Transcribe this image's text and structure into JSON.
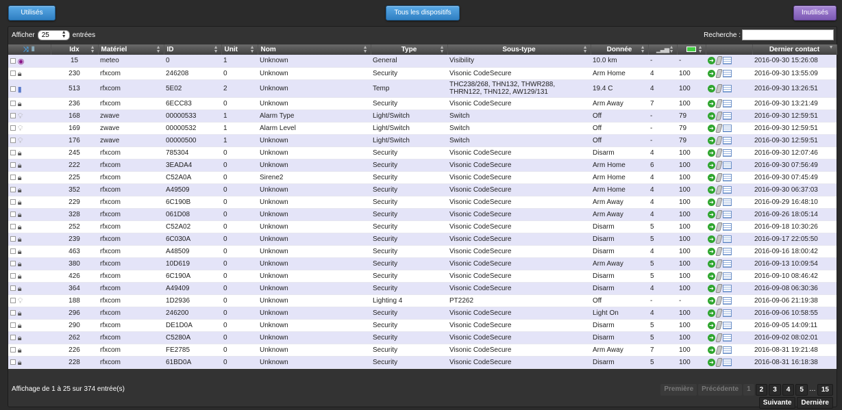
{
  "buttons": {
    "used": "Utilisés",
    "all": "Tous les dispositifs",
    "unused": "Inutilisés"
  },
  "toolbar": {
    "show_prefix": "Afficher",
    "page_size": "25",
    "show_suffix": "entrées",
    "search_label": "Recherche :",
    "search_value": ""
  },
  "table": {
    "headers": {
      "idx": "Idx",
      "hardware": "Matériel",
      "id": "ID",
      "unit": "Unit",
      "name": "Nom",
      "type": "Type",
      "subtype": "Sous-type",
      "data": "Donnée",
      "last_seen": "Dernier contact"
    },
    "rows": [
      {
        "icon": "eye",
        "idx": "15",
        "hw": "meteo",
        "id": "0",
        "unit": "1",
        "name": "Unknown",
        "type": "General",
        "sub": "Visibility",
        "data": "10.0 km",
        "sig": "-",
        "batt": "-",
        "last": "2016-09-30 15:26:08"
      },
      {
        "icon": "lock",
        "idx": "230",
        "hw": "rfxcom",
        "id": "246208",
        "unit": "0",
        "name": "Unknown",
        "type": "Security",
        "sub": "Visonic CodeSecure",
        "data": "Arm Home",
        "sig": "4",
        "batt": "100",
        "last": "2016-09-30 13:55:09"
      },
      {
        "icon": "temp",
        "idx": "513",
        "hw": "rfxcom",
        "id": "5E02",
        "unit": "2",
        "name": "Unknown",
        "type": "Temp",
        "sub": "THC238/268, THN132, THWR288, THRN122, THN122, AW129/131",
        "data": "19.4 C",
        "sig": "4",
        "batt": "100",
        "last": "2016-09-30 13:26:51"
      },
      {
        "icon": "lock",
        "idx": "236",
        "hw": "rfxcom",
        "id": "6ECC83",
        "unit": "0",
        "name": "Unknown",
        "type": "Security",
        "sub": "Visonic CodeSecure",
        "data": "Arm Away",
        "sig": "7",
        "batt": "100",
        "last": "2016-09-30 13:21:49"
      },
      {
        "icon": "bulb",
        "idx": "168",
        "hw": "zwave",
        "id": "00000533",
        "unit": "1",
        "name": "Alarm Type",
        "type": "Light/Switch",
        "sub": "Switch",
        "data": "Off",
        "sig": "-",
        "batt": "79",
        "last": "2016-09-30 12:59:51"
      },
      {
        "icon": "bulb",
        "idx": "169",
        "hw": "zwave",
        "id": "00000532",
        "unit": "1",
        "name": "Alarm Level",
        "type": "Light/Switch",
        "sub": "Switch",
        "data": "Off",
        "sig": "-",
        "batt": "79",
        "last": "2016-09-30 12:59:51"
      },
      {
        "icon": "bulb",
        "idx": "176",
        "hw": "zwave",
        "id": "00000500",
        "unit": "1",
        "name": "Unknown",
        "type": "Light/Switch",
        "sub": "Switch",
        "data": "Off",
        "sig": "-",
        "batt": "79",
        "last": "2016-09-30 12:59:51"
      },
      {
        "icon": "lock",
        "idx": "245",
        "hw": "rfxcom",
        "id": "785304",
        "unit": "0",
        "name": "Unknown",
        "type": "Security",
        "sub": "Visonic CodeSecure",
        "data": "Disarm",
        "sig": "4",
        "batt": "100",
        "last": "2016-09-30 12:07:46"
      },
      {
        "icon": "lock",
        "idx": "222",
        "hw": "rfxcom",
        "id": "3EADA4",
        "unit": "0",
        "name": "Unknown",
        "type": "Security",
        "sub": "Visonic CodeSecure",
        "data": "Arm Home",
        "sig": "6",
        "batt": "100",
        "last": "2016-09-30 07:56:49"
      },
      {
        "icon": "lock",
        "idx": "225",
        "hw": "rfxcom",
        "id": "C52A0A",
        "unit": "0",
        "name": "Sirene2",
        "type": "Security",
        "sub": "Visonic CodeSecure",
        "data": "Arm Home",
        "sig": "4",
        "batt": "100",
        "last": "2016-09-30 07:45:49"
      },
      {
        "icon": "lock",
        "idx": "352",
        "hw": "rfxcom",
        "id": "A49509",
        "unit": "0",
        "name": "Unknown",
        "type": "Security",
        "sub": "Visonic CodeSecure",
        "data": "Arm Home",
        "sig": "4",
        "batt": "100",
        "last": "2016-09-30 06:37:03"
      },
      {
        "icon": "lock",
        "idx": "229",
        "hw": "rfxcom",
        "id": "6C190B",
        "unit": "0",
        "name": "Unknown",
        "type": "Security",
        "sub": "Visonic CodeSecure",
        "data": "Arm Away",
        "sig": "4",
        "batt": "100",
        "last": "2016-09-29 16:48:10"
      },
      {
        "icon": "lock",
        "idx": "328",
        "hw": "rfxcom",
        "id": "061D08",
        "unit": "0",
        "name": "Unknown",
        "type": "Security",
        "sub": "Visonic CodeSecure",
        "data": "Arm Away",
        "sig": "4",
        "batt": "100",
        "last": "2016-09-26 18:05:14"
      },
      {
        "icon": "lock",
        "idx": "252",
        "hw": "rfxcom",
        "id": "C52A02",
        "unit": "0",
        "name": "Unknown",
        "type": "Security",
        "sub": "Visonic CodeSecure",
        "data": "Disarm",
        "sig": "5",
        "batt": "100",
        "last": "2016-09-18 10:30:26"
      },
      {
        "icon": "lock",
        "idx": "239",
        "hw": "rfxcom",
        "id": "6C030A",
        "unit": "0",
        "name": "Unknown",
        "type": "Security",
        "sub": "Visonic CodeSecure",
        "data": "Disarm",
        "sig": "5",
        "batt": "100",
        "last": "2016-09-17 22:05:50"
      },
      {
        "icon": "lock",
        "idx": "463",
        "hw": "rfxcom",
        "id": "A48509",
        "unit": "0",
        "name": "Unknown",
        "type": "Security",
        "sub": "Visonic CodeSecure",
        "data": "Disarm",
        "sig": "4",
        "batt": "100",
        "last": "2016-09-16 18:00:42"
      },
      {
        "icon": "lock",
        "idx": "380",
        "hw": "rfxcom",
        "id": "10D619",
        "unit": "0",
        "name": "Unknown",
        "type": "Security",
        "sub": "Visonic CodeSecure",
        "data": "Arm Away",
        "sig": "5",
        "batt": "100",
        "last": "2016-09-13 10:09:54"
      },
      {
        "icon": "lock",
        "idx": "426",
        "hw": "rfxcom",
        "id": "6C190A",
        "unit": "0",
        "name": "Unknown",
        "type": "Security",
        "sub": "Visonic CodeSecure",
        "data": "Disarm",
        "sig": "5",
        "batt": "100",
        "last": "2016-09-10 08:46:42"
      },
      {
        "icon": "lock",
        "idx": "364",
        "hw": "rfxcom",
        "id": "A49409",
        "unit": "0",
        "name": "Unknown",
        "type": "Security",
        "sub": "Visonic CodeSecure",
        "data": "Disarm",
        "sig": "4",
        "batt": "100",
        "last": "2016-09-08 06:30:36"
      },
      {
        "icon": "bulb",
        "idx": "188",
        "hw": "rfxcom",
        "id": "1D2936",
        "unit": "0",
        "name": "Unknown",
        "type": "Lighting 4",
        "sub": "PT2262",
        "data": "Off",
        "sig": "-",
        "batt": "-",
        "last": "2016-09-06 21:19:38"
      },
      {
        "icon": "lock",
        "idx": "296",
        "hw": "rfxcom",
        "id": "246200",
        "unit": "0",
        "name": "Unknown",
        "type": "Security",
        "sub": "Visonic CodeSecure",
        "data": "Light On",
        "sig": "4",
        "batt": "100",
        "last": "2016-09-06 10:58:55"
      },
      {
        "icon": "lock",
        "idx": "290",
        "hw": "rfxcom",
        "id": "DE1D0A",
        "unit": "0",
        "name": "Unknown",
        "type": "Security",
        "sub": "Visonic CodeSecure",
        "data": "Disarm",
        "sig": "5",
        "batt": "100",
        "last": "2016-09-05 14:09:11"
      },
      {
        "icon": "lock",
        "idx": "262",
        "hw": "rfxcom",
        "id": "C5280A",
        "unit": "0",
        "name": "Unknown",
        "type": "Security",
        "sub": "Visonic CodeSecure",
        "data": "Disarm",
        "sig": "5",
        "batt": "100",
        "last": "2016-09-02 08:02:01"
      },
      {
        "icon": "lock",
        "idx": "226",
        "hw": "rfxcom",
        "id": "FE2785",
        "unit": "0",
        "name": "Unknown",
        "type": "Security",
        "sub": "Visonic CodeSecure",
        "data": "Arm Away",
        "sig": "7",
        "batt": "100",
        "last": "2016-08-31 19:21:48"
      },
      {
        "icon": "lock",
        "idx": "228",
        "hw": "rfxcom",
        "id": "61BD0A",
        "unit": "0",
        "name": "Unknown",
        "type": "Security",
        "sub": "Visonic CodeSecure",
        "data": "Disarm",
        "sig": "5",
        "batt": "100",
        "last": "2016-08-31 16:18:38"
      }
    ]
  },
  "footer": {
    "info": "Affichage de 1 à 25 sur 374 entrée(s)",
    "first": "Première",
    "prev": "Précédente",
    "pages": [
      "1",
      "2",
      "3",
      "4",
      "5"
    ],
    "ellipsis": "…",
    "last_page": "15",
    "next": "Suivante",
    "last": "Dernière"
  }
}
